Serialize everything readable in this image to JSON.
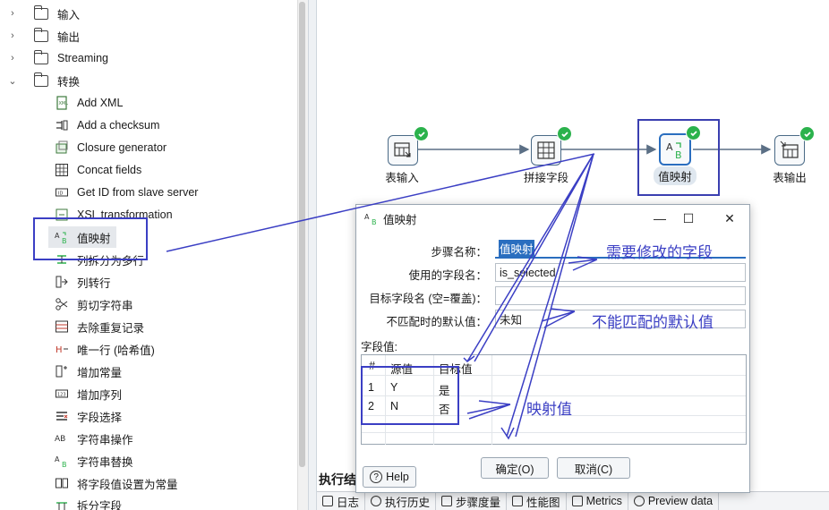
{
  "tree": {
    "folders": [
      {
        "label": "输入",
        "expanded": false
      },
      {
        "label": "输出",
        "expanded": false
      },
      {
        "label": "Streaming",
        "expanded": false
      },
      {
        "label": "转换",
        "expanded": true
      }
    ],
    "items": [
      {
        "label": "Add XML",
        "icon": "add-xml-icon"
      },
      {
        "label": "Add a checksum",
        "icon": "checksum-icon"
      },
      {
        "label": "Closure generator",
        "icon": "closure-icon"
      },
      {
        "label": "Concat fields",
        "icon": "concat-icon"
      },
      {
        "label": "Get ID from slave server",
        "icon": "id-icon"
      },
      {
        "label": "XSL transformation",
        "icon": "xsl-icon"
      },
      {
        "label": "值映射",
        "icon": "value-mapper-icon"
      },
      {
        "label": "列拆分为多行",
        "icon": "split-rows-icon"
      },
      {
        "label": "列转行",
        "icon": "col-to-row-icon"
      },
      {
        "label": "剪切字符串",
        "icon": "scissors-icon"
      },
      {
        "label": "去除重复记录",
        "icon": "dedupe-icon"
      },
      {
        "label": "唯一行 (哈希值)",
        "icon": "unique-hash-icon"
      },
      {
        "label": "增加常量",
        "icon": "constant-icon"
      },
      {
        "label": "增加序列",
        "icon": "sequence-icon"
      },
      {
        "label": "字段选择",
        "icon": "select-fields-icon"
      },
      {
        "label": "字符串操作",
        "icon": "string-ops-icon"
      },
      {
        "label": "字符串替换",
        "icon": "string-replace-icon"
      },
      {
        "label": "将字段值设置为常量",
        "icon": "set-constant-icon"
      },
      {
        "label": "拆分字段",
        "icon": "split-field-icon"
      }
    ]
  },
  "canvas": {
    "nodes": [
      {
        "label": "表输入",
        "icon": "table-input-icon"
      },
      {
        "label": "拼接字段",
        "icon": "concat-icon"
      },
      {
        "label": "值映射",
        "icon": "value-mapper-icon"
      },
      {
        "label": "表输出",
        "icon": "table-output-icon"
      }
    ]
  },
  "bottom": {
    "title": "执行结",
    "tabs": [
      {
        "label": "日志",
        "icon": "log-icon"
      },
      {
        "label": "执行历史",
        "icon": "history-icon"
      },
      {
        "label": "步骤度量",
        "icon": "metrics-icon"
      },
      {
        "label": "性能图",
        "icon": "chart-icon"
      },
      {
        "label": "Metrics",
        "icon": "metrics-icon"
      },
      {
        "label": "Preview data",
        "icon": "eye-icon"
      }
    ]
  },
  "dialog": {
    "title": "值映射",
    "fields": {
      "step_name_label": "步骤名称：",
      "step_name_value": "值映射",
      "field_used_label": "使用的字段名：",
      "field_used_value": "is_selected",
      "target_field_label": "目标字段名 (空=覆盖)：",
      "target_field_value": "",
      "default_label": "不匹配时的默认值：",
      "default_value": "未知"
    },
    "grid_label": "字段值:",
    "grid": {
      "headers": [
        "#",
        "源值",
        "目标值"
      ],
      "rows": [
        {
          "num": "1",
          "source": "Y",
          "target": "是"
        },
        {
          "num": "2",
          "source": "N",
          "target": "否"
        }
      ]
    },
    "buttons": {
      "help": "Help",
      "ok": "确定(O)",
      "cancel": "取消(C)"
    }
  },
  "annotations": {
    "modify_field": "需要修改的字段",
    "default_value": "不能匹配的默认值",
    "mapping_values": "映射值"
  },
  "colors": {
    "annotation": "#3b3fc4",
    "check": "#2bb24c",
    "selection": "#2a6ebf"
  }
}
